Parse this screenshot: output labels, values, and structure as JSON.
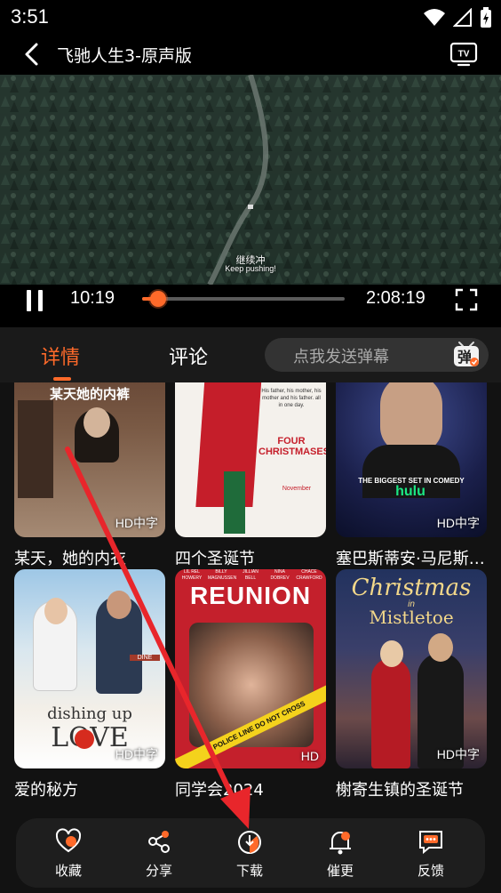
{
  "status_bar": {
    "time": "3:51"
  },
  "player": {
    "title": "飞驰人生3-原声版",
    "subtitle_cn": "继续冲",
    "subtitle_en": "Keep pushing!",
    "current_time": "10:19",
    "duration": "2:08:19",
    "progress": 0.08
  },
  "tabs": {
    "details": "详情",
    "comments": "评论",
    "danmaku_placeholder": "点我发送弹幕",
    "danmaku_icon_text": "弹"
  },
  "cards": [
    {
      "title": "某天，她的内衣",
      "badge": "HD中字",
      "poster_text": "某天她的内裤"
    },
    {
      "title": "四个圣诞节",
      "badge": "",
      "poster_text": "FOUR CHRISTMASES",
      "poster_tagline": "His father, his mother, his mother and his father. all in one day.",
      "poster_date": "November"
    },
    {
      "title": "塞巴斯蒂安·马尼斯…",
      "badge": "HD中字",
      "poster_text": "THE BIGGEST SET IN COMEDY",
      "poster_brand": "hulu"
    },
    {
      "title": "爱的秘方",
      "badge": "HD中字",
      "poster_text": "dishing up",
      "poster_text2": "LOVE",
      "poster_small": "DINE"
    },
    {
      "title": "同学会2024",
      "badge": "HD",
      "poster_text": "REUNION",
      "poster_names": [
        "LIL REL HOWERY",
        "BILLY MAGNUSSEN",
        "JILLIAN BELL",
        "NINA DOBREV",
        "CHACE CRAWFORD"
      ],
      "poster_tape": "POLICE LINE DO NOT CROSS"
    },
    {
      "title": "榭寄生镇的圣诞节",
      "badge": "HD中字",
      "poster_text": "Christmas",
      "poster_text_mid": "in",
      "poster_text2": "Mistletoe"
    }
  ],
  "actions": [
    {
      "label": "收藏",
      "icon": "heart-icon"
    },
    {
      "label": "分享",
      "icon": "share-icon"
    },
    {
      "label": "下载",
      "icon": "download-icon"
    },
    {
      "label": "催更",
      "icon": "bell-icon"
    },
    {
      "label": "反馈",
      "icon": "feedback-icon"
    }
  ],
  "colors": {
    "accent": "#ff6a2a",
    "background": "#121212",
    "annotation": "#e8262b"
  }
}
